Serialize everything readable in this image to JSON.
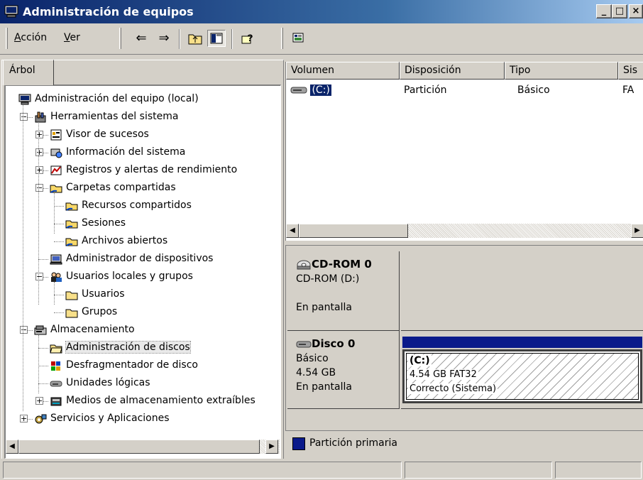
{
  "window": {
    "title": "Administración de equipos",
    "buttons": {
      "minimize": "_",
      "maximize": "□",
      "close": "×"
    }
  },
  "toolbar": {
    "menu": [
      {
        "label": "Acción",
        "underline": "A",
        "rest": "cción"
      },
      {
        "label": "Ver",
        "underline": "V",
        "rest": "er"
      }
    ],
    "buttons": {
      "back": "⇐",
      "forward": "⇒",
      "up": "up-folder-icon",
      "show_hide_tree": "tree-toggle-icon",
      "help": "help-icon",
      "action": "disk-properties-icon"
    }
  },
  "left": {
    "tab_label": "Árbol",
    "tree": [
      {
        "label": "Administración del equipo (local)",
        "icon": "computer-icon",
        "level": 0
      },
      {
        "label": "Herramientas del sistema",
        "icon": "tools-icon",
        "level": 1,
        "exp": "−"
      },
      {
        "label": "Visor de sucesos",
        "icon": "event-viewer-icon",
        "level": 2,
        "exp": "+"
      },
      {
        "label": "Información del sistema",
        "icon": "system-info-icon",
        "level": 2,
        "exp": "+"
      },
      {
        "label": "Registros y alertas de rendimiento",
        "icon": "performance-icon",
        "level": 2,
        "exp": "+"
      },
      {
        "label": "Carpetas compartidas",
        "icon": "shared-folder-icon",
        "level": 2,
        "exp": "−"
      },
      {
        "label": "Recursos compartidos",
        "icon": "shared-folder-icon",
        "level": 3
      },
      {
        "label": "Sesiones",
        "icon": "shared-folder-icon",
        "level": 3
      },
      {
        "label": "Archivos abiertos",
        "icon": "shared-folder-icon",
        "level": 3
      },
      {
        "label": "Administrador de dispositivos",
        "icon": "device-manager-icon",
        "level": 2
      },
      {
        "label": "Usuarios locales y grupos",
        "icon": "users-icon",
        "level": 2,
        "exp": "−"
      },
      {
        "label": "Usuarios",
        "icon": "folder-icon",
        "level": 3
      },
      {
        "label": "Grupos",
        "icon": "folder-icon",
        "level": 3
      },
      {
        "label": "Almacenamiento",
        "icon": "storage-icon",
        "level": 1,
        "exp": "−"
      },
      {
        "label": "Administración de discos",
        "icon": "open-folder-icon",
        "level": 2,
        "selected": true
      },
      {
        "label": "Desfragmentador de disco",
        "icon": "defrag-icon",
        "level": 2
      },
      {
        "label": "Unidades lógicas",
        "icon": "logical-drive-icon",
        "level": 2
      },
      {
        "label": "Medios de almacenamiento extraíbles",
        "icon": "removable-storage-icon",
        "level": 2,
        "exp": "+"
      },
      {
        "label": "Servicios y Aplicaciones",
        "icon": "services-icon",
        "level": 1,
        "exp": "+"
      }
    ]
  },
  "volumes": {
    "columns": [
      "Volumen",
      "Disposición",
      "Tipo",
      "Sis"
    ],
    "rows": [
      {
        "volume": "(C:)",
        "layout": "Partición",
        "type": "Básico",
        "fs": "FA"
      }
    ]
  },
  "disks": [
    {
      "name": "CD-ROM 0",
      "icon": "cdrom-icon",
      "line1": "CD-ROM (D:)",
      "line2": "",
      "status": "En pantalla"
    },
    {
      "name": "Disco 0",
      "icon": "disk-icon",
      "line1": "Básico",
      "line2": "4.54 GB",
      "status": "En pantalla",
      "partition": {
        "label": "(C:)",
        "size": "4.54 GB FAT32",
        "status": "Correcto (Sistema)"
      }
    }
  ],
  "legend": {
    "label": "Partición primaria",
    "color": "#0a1a8a"
  },
  "colors": {
    "title_start": "#0a246a",
    "primary_partition": "#0a1a8a",
    "selection": "#0a246a"
  }
}
